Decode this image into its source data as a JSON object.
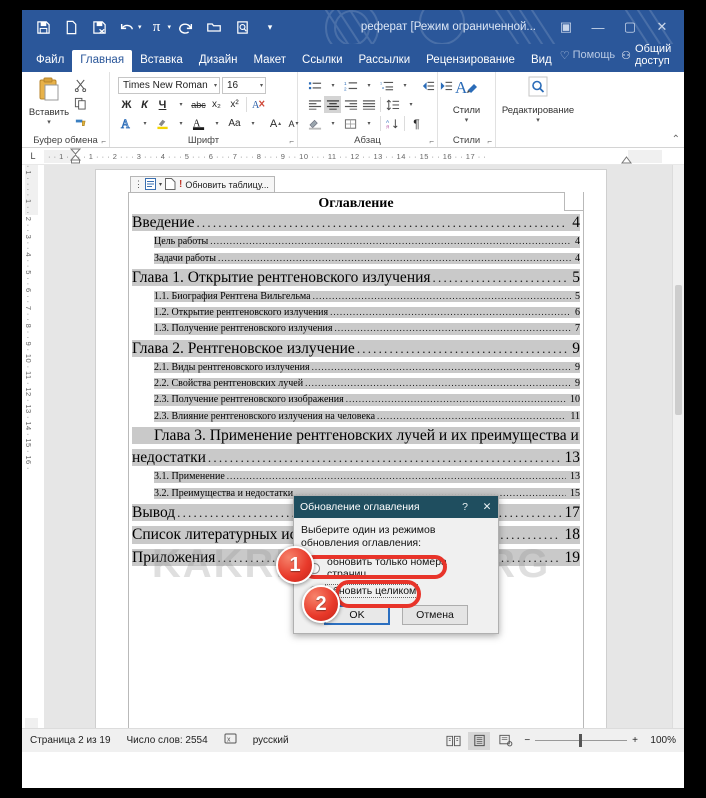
{
  "window": {
    "title": "реферат [Режим ограниченной...",
    "quick_access": [
      "save-icon",
      "new-icon",
      "save-as-icon",
      "undo-icon",
      "redo-pi-icon",
      "repeat-icon",
      "open-icon",
      "print-preview-icon",
      "customize-qat-icon"
    ],
    "buttons": {
      "ribbon_display": "▣",
      "minimize": "—",
      "maximize": "▢",
      "close": "✕"
    },
    "accent": "#2b579a"
  },
  "tabs": {
    "items": [
      "Файл",
      "Главная",
      "Вставка",
      "Дизайн",
      "Макет",
      "Ссылки",
      "Рассылки",
      "Рецензирование",
      "Вид"
    ],
    "active": "Главная",
    "help_placeholder": "Помощь",
    "share_label": "Общий доступ"
  },
  "ribbon": {
    "groups": [
      {
        "label": "Буфер обмена",
        "big_button": "Вставить"
      },
      {
        "label": "Шрифт"
      },
      {
        "label": "Абзац"
      },
      {
        "label": "Стили",
        "big_button": "Стили"
      },
      {
        "label": "",
        "big_button": "Редактирование"
      }
    ],
    "font_name": "Times New Roman",
    "font_size": "16",
    "styles_label": "Стили",
    "editing_label": "Редактирование",
    "paste_label": "Вставить",
    "clipboard_label": "Буфер обмена",
    "font_label": "Шрифт",
    "paragraph_label": "Абзац",
    "bold": "Ж",
    "italic": "К",
    "underline": "Ч",
    "strikethrough": "abc",
    "subscript": "x₂",
    "superscript": "x²",
    "clear_format": "clear-formatting-icon",
    "grow_font": "A",
    "shrink_font": "A",
    "change_case": "Aa",
    "pilcrow": "¶"
  },
  "ruler": {
    "horizontal": "·  ·  1  ·  ·  ·  ·  1  ·  ·  ·  2  ·  ·  ·  3  ·  ·  ·  4  ·  ·  ·  5  ·  ·  ·  6  ·  ·  ·  7  ·  ·  ·  8  ·  ·  ·  9  ·  ·  10  ·  ·  ·  11  ·  ·  12  ·  ·  13  ·  ·  14  ·  ·  15  ·  ·  16  ·  ·  17  ·  ·",
    "vertical": "·  1  ·  ·  ·  ·  1  ·  ·  2  ·  ·  3  ·  ·  4  ·  ·  5  ·  ·  6  ·  ·  7  ·  ·  8  ·  ·  9  ·  10  ·  11  ·  12  ·  13  ·  14  ·  15  ·  16  ·",
    "tab_selector": "L"
  },
  "document": {
    "watermark": "KAKREFERAT.ORG",
    "toc_chip": {
      "update_label": "Обновить таблицу...",
      "caret": "▾"
    },
    "toc_title": "Оглавление",
    "entries": [
      {
        "label": "Введение",
        "page": "4",
        "level": 1
      },
      {
        "label": "Цель работы",
        "page": "4",
        "level": 2
      },
      {
        "label": "Задачи работы",
        "page": "4",
        "level": 2
      },
      {
        "label": "Глава 1. Открытие рентгеновского излучения",
        "page": "5",
        "level": 1
      },
      {
        "label": "1.1. Биография Рентгена Вильгельма",
        "page": "5",
        "level": 2
      },
      {
        "label": "1.2. Открытие рентгеновского излучения",
        "page": "6",
        "level": 2
      },
      {
        "label": "1.3. Получение рентгеновского излучения",
        "page": "7",
        "level": 2
      },
      {
        "label": "Глава 2. Рентгеновское излучение",
        "page": "9",
        "level": 1
      },
      {
        "label": "2.1. Виды рентгеновского излучения",
        "page": "9",
        "level": 2
      },
      {
        "label": "2.2. Свойства рентгеновских лучей",
        "page": "9",
        "level": 2
      },
      {
        "label": "2.3. Получение рентгеновского изображения",
        "page": "10",
        "level": 2
      },
      {
        "label": "2.3. Влияние рентгеновского излучения на человека",
        "page": "11",
        "level": 2
      },
      {
        "label": "Глава 3. Применение рентгеновских лучей и их преимущества и",
        "page": "",
        "level": 1,
        "wrap": true
      },
      {
        "label": "недостатки",
        "page": "13",
        "level": 1
      },
      {
        "label": "3.1. Применение",
        "page": "13",
        "level": 2
      },
      {
        "label": "3.2. Преимущества и недостатки",
        "page": "15",
        "level": 2
      },
      {
        "label": "Вывод",
        "page": "17",
        "level": 1
      },
      {
        "label": "Список литературных источников",
        "page": "18",
        "level": 1
      },
      {
        "label": "Приложения",
        "page": "19",
        "level": 1
      }
    ]
  },
  "dialog": {
    "title": "Обновление оглавления",
    "help_btn": "?",
    "close_btn": "✕",
    "prompt": "Выберите один из режимов обновления оглавления:",
    "options": [
      {
        "label": "обновить только номера страниц",
        "selected": false
      },
      {
        "label": "обновить целиком",
        "selected": true
      }
    ],
    "ok_label": "OK",
    "cancel_label": "Отмена"
  },
  "callouts": [
    {
      "number": "1"
    },
    {
      "number": "2"
    }
  ],
  "statusbar": {
    "page": "Страница 2 из 19",
    "words": "Число слов: 2554",
    "proofing_icon": "spelling-check-icon",
    "language": "русский",
    "views": [
      "read-mode-icon",
      "print-layout-icon",
      "web-layout-icon"
    ],
    "active_view": "print-layout-icon",
    "zoom_out": "−",
    "zoom_in": "+",
    "zoom": "100%"
  }
}
